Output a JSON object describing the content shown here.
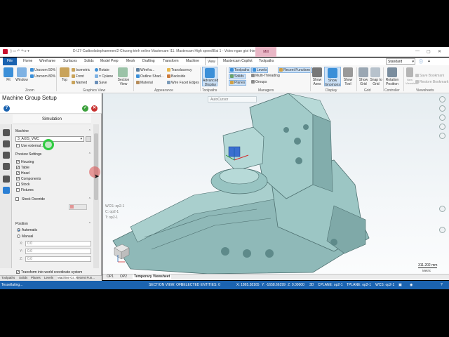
{
  "titlebar": {
    "title": "D:\\17-Cadtoolsdephammen\\2-Chuong trinh online Mastercam \\11. Mastercam High speed\\Bai 1 - Video ngan gioi thieu 2D...",
    "mill_tab": "Mill"
  },
  "ribbon_tabs": [
    "File",
    "Home",
    "Wireframe",
    "Surfaces",
    "Solids",
    "Model Prep",
    "Mesh",
    "Drafting",
    "Transform",
    "Machine",
    "View",
    "Mastercam Copilot",
    "Toolpaths"
  ],
  "active_tab": "View",
  "standard_select": "Standard",
  "ribbon": {
    "zoom": {
      "label": "Zoom",
      "fit": "Fit",
      "window": "Window",
      "unzoom50": "Unzoom 50%",
      "unzoom80": "Unzoom 80%"
    },
    "graphics_view": {
      "label": "Graphics View",
      "top": "Top",
      "isometric": "Isometric",
      "front": "Front",
      "named": "Named",
      "rotate": "Rotate",
      "cplane": "= Cplane",
      "save": "Save",
      "section_view": "Section View"
    },
    "appearance": {
      "label": "Appearance",
      "wireframe": "Wirefra...",
      "outline_shaded": "Outline Shad...",
      "material": "Material",
      "translucency": "Translucency",
      "backside": "Backside",
      "wire_facet_edges": "Wire Facet Edges"
    },
    "toolpaths": {
      "label": "Toolpaths",
      "advanced_display": "Advanced Display"
    },
    "managers": {
      "label": "Managers",
      "toolpaths": "Toolpaths",
      "solids": "Solids",
      "planes": "Planes",
      "levels": "Levels",
      "multi_threading": "Multi-Threading",
      "groups": "Groups",
      "recent_functions": "Recent Functions"
    },
    "display": {
      "label": "Display",
      "show_axes": "Show Axes",
      "show_gnomons": "Show Gnomons",
      "show_tool": "Show Tool"
    },
    "grid": {
      "label": "Grid",
      "show_grid": "Show Grid",
      "snap_to_grid": "Snap to Grid"
    },
    "controller": {
      "label": "Controller",
      "rotation_position": "Rotation Position"
    },
    "viewsheets": {
      "label": "Viewsheets",
      "new_viewsheet": "New Viewsheet",
      "save_bookmark": "Save Bookmark",
      "restore_bookmark": "Restore Bookmark"
    }
  },
  "panel": {
    "title": "Machine Group Setup",
    "subtitle": "Simulation",
    "machine_section": "Machine",
    "machine_value": "3_AXIS_VMC",
    "use_external": "Use external...",
    "preview_section": "Preview Settings",
    "preview_items": [
      {
        "label": "Housing",
        "checked": true
      },
      {
        "label": "Table",
        "checked": true
      },
      {
        "label": "Head",
        "checked": true
      },
      {
        "label": "Components",
        "checked": true
      },
      {
        "label": "Stock",
        "checked": false
      },
      {
        "label": "Fixtures",
        "checked": false
      }
    ],
    "stock_override": "Stock Override",
    "position_section": "Position",
    "automatic": "Automatic",
    "manual": "Manual",
    "coords": [
      {
        "axis": "X:",
        "value": "0.0"
      },
      {
        "axis": "Y:",
        "value": "0.0"
      },
      {
        "axis": "Z:",
        "value": "0.0"
      }
    ],
    "transform_label": "Transform into world coordinate system"
  },
  "panel_tabs": [
    "Toolpaths",
    "Solids",
    "Planes",
    "Levels",
    "Machine Gr...",
    "Recent Fun..."
  ],
  "viewport": {
    "autocursor": "AutoCursor",
    "wcs": "WCS: op2-1",
    "cplane": "C: op2-1",
    "tplane": "T: op2-1",
    "scale": "311.202 mm",
    "units": "Metric"
  },
  "worksheet_tabs": [
    "OP1",
    "OP2",
    "Temporary Viewsheet"
  ],
  "active_worksheet": "Temporary Viewsheet",
  "statusbar": {
    "left": "Tessellating...",
    "section_view": "SECTION VIEW: OFF",
    "selected": "SELECTED ENTITIES: 0",
    "x": "X: 1865.58165",
    "y": "Y: -1658.66299",
    "z": "Z: 0.00000",
    "dim": "3D",
    "cplane": "CPLANE: op2-1",
    "tplane": "TPLANE: op2-1",
    "wcs": "WCS: op2-1"
  },
  "colors": {
    "accent": "#1b63b0",
    "machine_body": "#7fb0b0",
    "highlight": "#cde2f7",
    "mill_tab": "#e9b7c6"
  }
}
